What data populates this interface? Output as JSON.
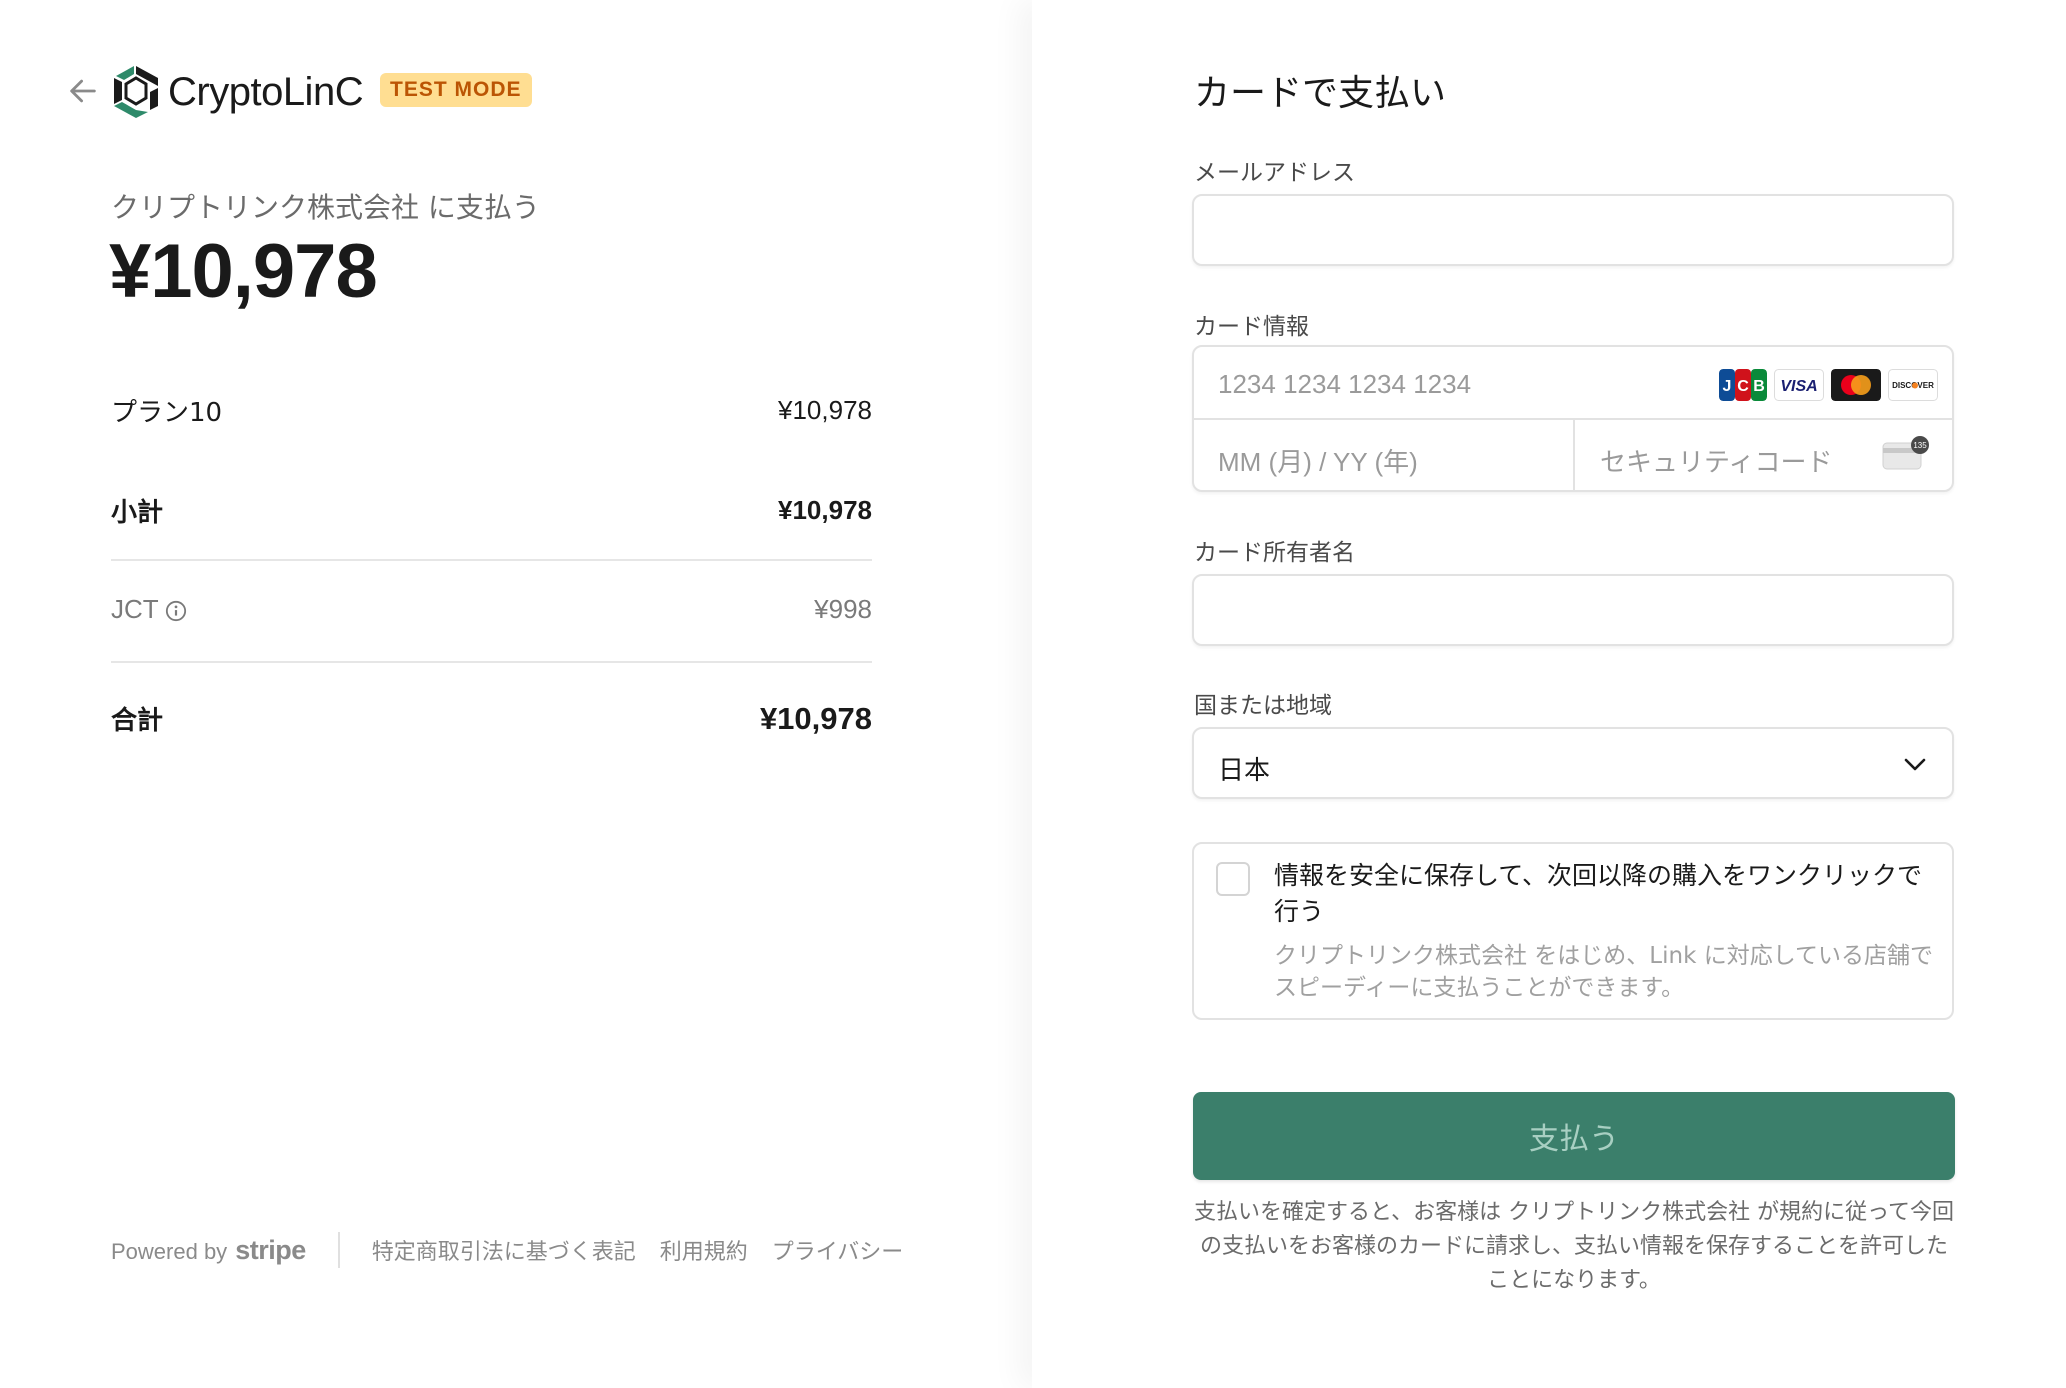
{
  "header": {
    "brand_name": "CryptoLinC",
    "test_mode_badge": "TEST MODE"
  },
  "summary": {
    "pay_to": "クリプトリンク株式会社 に支払う",
    "amount": "¥10,978",
    "line_items": [
      {
        "label": "プラン10",
        "value": "¥10,978"
      },
      {
        "label": "小計",
        "value": "¥10,978"
      },
      {
        "label": "JCT",
        "value": "¥998"
      },
      {
        "label": "合計",
        "value": "¥10,978"
      }
    ]
  },
  "footer": {
    "powered_by": "Powered by",
    "stripe": "stripe",
    "links": [
      "特定商取引法に基づく表記",
      "利用規約",
      "プライバシー"
    ]
  },
  "form": {
    "title": "カードで支払い",
    "email_label": "メールアドレス",
    "email_value": "",
    "card_label": "カード情報",
    "card_number_placeholder": "1234 1234 1234 1234",
    "card_expiry_placeholder": "MM (月) / YY (年)",
    "card_cvc_placeholder": "セキュリティコード",
    "card_brands": [
      "JCB",
      "VISA",
      "Mastercard",
      "DISCOVER"
    ],
    "cvc_icon_text": "135",
    "cardholder_label": "カード所有者名",
    "cardholder_value": "",
    "country_label": "国または地域",
    "country_value": "日本",
    "save_title": "情報を安全に保存して、次回以降の購入をワンクリックで行う",
    "save_description": "クリプトリンク株式会社 をはじめ、Link に対応している店舗でスピーディーに支払うことができます。",
    "pay_button": "支払う",
    "disclaimer": "支払いを確定すると、お客様は クリプトリンク株式会社 が規約に従って今回の支払いをお客様のカードに請求し、支払い情報を保存することを許可したことになります。"
  },
  "colors": {
    "pay_button": "#3b7f6b",
    "badge_bg": "#ffde92",
    "badge_text": "#bb5504",
    "logo_green": "#2e8a6a"
  }
}
